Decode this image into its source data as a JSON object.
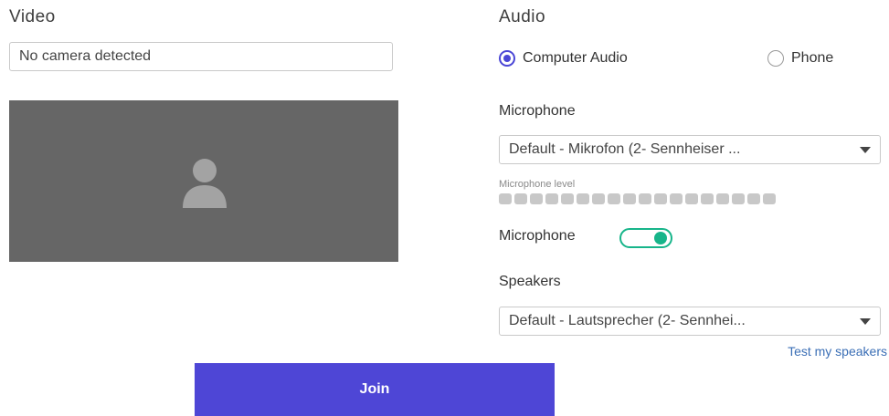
{
  "video": {
    "title": "Video",
    "camera_value": "No camera detected"
  },
  "audio": {
    "title": "Audio",
    "options": [
      {
        "label": "Computer Audio",
        "selected": true
      },
      {
        "label": "Phone",
        "selected": false
      }
    ],
    "microphone_label": "Microphone",
    "microphone_value": "Default - Mikrofon (2- Sennheiser ...",
    "microphone_level_label": "Microphone level",
    "microphone_level_segments": 18,
    "microphone_level_active": 0,
    "microphone_toggle_label": "Microphone",
    "microphone_toggle_on": true,
    "speakers_label": "Speakers",
    "speakers_value": "Default - Lautsprecher (2- Sennhei...",
    "test_speakers_link": "Test my speakers"
  },
  "join_label": "Join",
  "colors": {
    "accent": "#4e46d6",
    "toggle_on": "#17b58a",
    "preview_bg": "#666666",
    "link": "#3b6fb6"
  },
  "icons": [
    "avatar-icon",
    "radio-selected-icon",
    "radio-unselected-icon",
    "dropdown-caret-icon"
  ]
}
